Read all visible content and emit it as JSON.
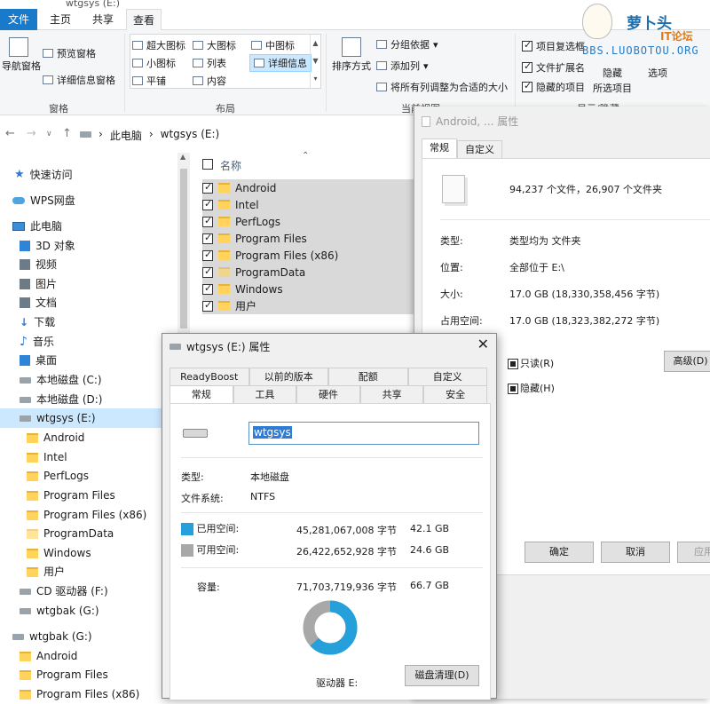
{
  "window": {
    "title": "wtgsys (E:)"
  },
  "ribbon": {
    "tabs": [
      "文件",
      "主页",
      "共享",
      "查看"
    ],
    "pane_group": {
      "label": "窗格",
      "nav_pane": "导航窗格",
      "preview": "预览窗格",
      "details": "详细信息窗格"
    },
    "layout_group": {
      "label": "布局",
      "items": [
        "超大图标",
        "大图标",
        "中图标",
        "小图标",
        "列表",
        "详细信息",
        "平铺",
        "内容"
      ]
    },
    "current_view": {
      "label": "当前视图",
      "sort": "排序方式",
      "group": "分组依据",
      "add_col": "添加列",
      "fit_col": "将所有列调整为合适的大小"
    },
    "show_hide": {
      "label": "显示/隐藏",
      "item_checkbox": "项目复选框",
      "ext": "文件扩展名",
      "hidden": "隐藏的项目",
      "hide_sel_1": "隐藏",
      "hide_sel_2": "所选项目",
      "options": "选项"
    }
  },
  "logo": {
    "name": "萝卜头",
    "sub": "IT论坛",
    "url": "BBS.LUOBOTOU.ORG"
  },
  "address": {
    "crumbs": [
      "此电脑",
      "wtgsys (E:)"
    ]
  },
  "nav": {
    "items": [
      "快速访问",
      "WPS网盘",
      "此电脑",
      "3D 对象",
      "视频",
      "图片",
      "文档",
      "下载",
      "音乐",
      "桌面",
      "本地磁盘 (C:)",
      "本地磁盘 (D:)",
      "wtgsys (E:)",
      "Android",
      "Intel",
      "PerfLogs",
      "Program Files",
      "Program Files (x86)",
      "ProgramData",
      "Windows",
      "用户",
      "CD 驱动器 (F:)",
      "wtgbak (G:)",
      "wtgbak (G:)",
      "Android",
      "Program Files",
      "Program Files (x86)"
    ]
  },
  "filelist": {
    "column": "名称",
    "rows": [
      "Android",
      "Intel",
      "PerfLogs",
      "Program Files",
      "Program Files (x86)",
      "ProgramData",
      "Windows",
      "用户"
    ]
  },
  "prop_right": {
    "title": "Android, ... 属性",
    "tabs": [
      "常规",
      "自定义"
    ],
    "summary": "94,237 个文件，26,907 个文件夹",
    "type_label": "类型:",
    "type_value": "类型均为 文件夹",
    "location_label": "位置:",
    "location_value": "全部位于 E:\\",
    "size_label": "大小:",
    "size_value": "17.0 GB (18,330,358,456 字节)",
    "disk_label": "占用空间:",
    "disk_value": "17.0 GB (18,323,382,272 字节)",
    "readonly": "只读(R)",
    "hidden": "隐藏(H)",
    "advanced": "高级(D)",
    "ok": "确定",
    "cancel": "取消",
    "apply": "应用"
  },
  "prop_front": {
    "title": "wtgsys (E:) 属性",
    "tabs_row1": [
      "ReadyBoost",
      "以前的版本",
      "配额",
      "自定义"
    ],
    "tabs_row2": [
      "常规",
      "工具",
      "硬件",
      "共享",
      "安全"
    ],
    "volume_name": "wtgsys",
    "type_label": "类型:",
    "type_value": "本地磁盘",
    "fs_label": "文件系统:",
    "fs_value": "NTFS",
    "used_label": "已用空间:",
    "used_bytes": "45,281,067,008 字节",
    "used_gb": "42.1 GB",
    "free_label": "可用空间:",
    "free_bytes": "26,422,652,928 字节",
    "free_gb": "24.6 GB",
    "cap_label": "容量:",
    "cap_bytes": "71,703,719,936 字节",
    "cap_gb": "66.7 GB",
    "drive_label": "驱动器 E:",
    "cleanup": "磁盘清理(D)",
    "used_fraction": 0.6315,
    "colors": {
      "used": "#26a0da",
      "free": "#a8a8a8"
    }
  }
}
